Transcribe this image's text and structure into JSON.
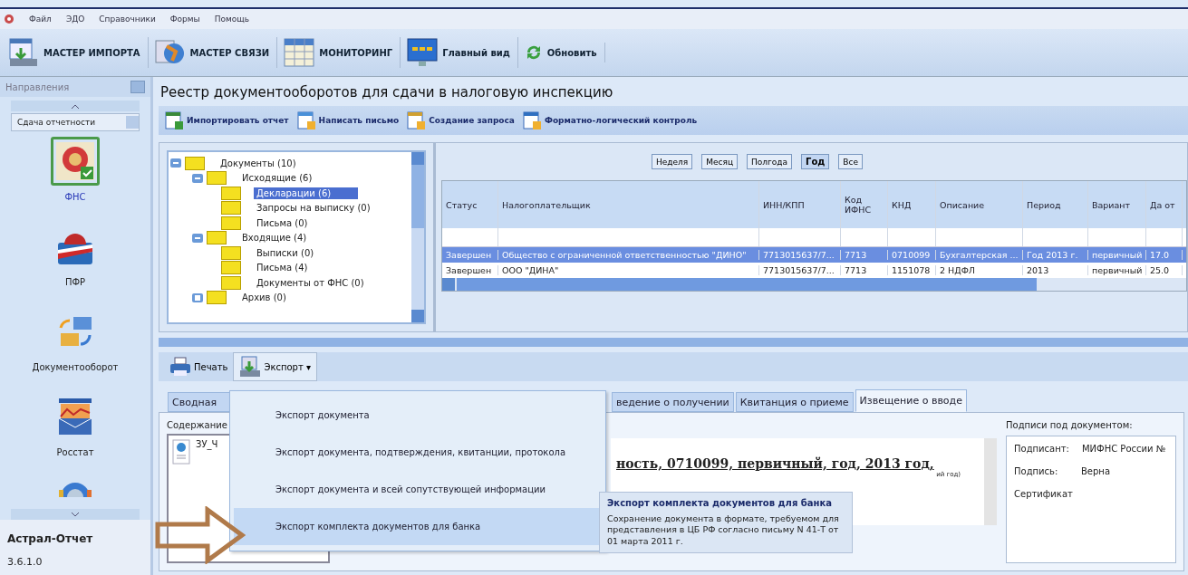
{
  "menu_bar": [
    "Файл",
    "ЭДО",
    "Справочники",
    "Формы",
    "Помощь"
  ],
  "toolbar": [
    {
      "label": "МАСТЕР ИМПОРТА",
      "kind": "import"
    },
    {
      "label": "МАСТЕР СВЯЗИ",
      "kind": "link"
    },
    {
      "label": "МОНИТОРИНГ",
      "kind": "grid"
    },
    {
      "label": "Главный вид",
      "kind": "monitor"
    },
    {
      "label": "Обновить",
      "kind": "refresh"
    }
  ],
  "sidebar": {
    "header": "Направления",
    "dropdown": "Сдача отчетности",
    "items": [
      {
        "label": "ФНС",
        "kind": "fns",
        "selected": true
      },
      {
        "label": "ПФР",
        "kind": "pfr",
        "selected": false
      },
      {
        "label": "Документооборот",
        "kind": "docs",
        "selected": false
      },
      {
        "label": "Росстат",
        "kind": "stat",
        "selected": false
      }
    ],
    "app_name": "Астрал-Отчет",
    "version": "3.6.1.0"
  },
  "title": "Реестр документооборотов для сдачи в налоговую инспекцию",
  "actions": [
    {
      "label": "Импортировать отчет",
      "kind": "import"
    },
    {
      "label": "Написать письмо",
      "kind": "mail"
    },
    {
      "label": "Создание запроса",
      "kind": "request"
    },
    {
      "label": "Форматно-логический контроль",
      "kind": "check"
    }
  ],
  "tree": [
    {
      "label": "Документы (10)",
      "expanded": true,
      "selected": false,
      "children": [
        {
          "label": "Исходящие (6)",
          "expanded": true,
          "selected": false,
          "children": [
            {
              "label": "Декларации (6)",
              "selected": true
            },
            {
              "label": "Запросы на выписку (0)",
              "selected": false
            },
            {
              "label": "Письма (0)",
              "selected": false
            }
          ]
        },
        {
          "label": "Входящие (4)",
          "expanded": true,
          "selected": false,
          "children": [
            {
              "label": "Выписки (0)",
              "selected": false
            },
            {
              "label": "Письма (4)",
              "selected": false
            },
            {
              "label": "Документы от ФНС (0)",
              "selected": false
            }
          ]
        },
        {
          "label": "Архив (0)",
          "expanded": false,
          "selected": false
        }
      ]
    }
  ],
  "periods": [
    {
      "label": "Неделя",
      "selected": false
    },
    {
      "label": "Месяц",
      "selected": false
    },
    {
      "label": "Полгода",
      "selected": false
    },
    {
      "label": "Год",
      "selected": true
    },
    {
      "label": "Все",
      "selected": false
    }
  ],
  "table": {
    "columns": [
      "Статус",
      "Налогоплательщик",
      "ИНН/КПП",
      "Код ИФНС",
      "КНД",
      "Описание",
      "Период",
      "Вариант",
      "Да от"
    ],
    "rows": [
      {
        "selected": true,
        "cells": [
          "Завершен",
          "Общество с ограниченной ответственностью \"ДИНО\"",
          "7713015637/7...",
          "7713",
          "0710099",
          "Бухгалтерская ...",
          "Год 2013 г.",
          "первичный",
          "17.0"
        ]
      },
      {
        "selected": false,
        "cells": [
          "Завершен",
          "ООО \"ДИНА\"",
          "7713015637/7...",
          "7713",
          "1151078",
          "2 НДФЛ",
          "2013",
          "первичный",
          "25.0"
        ]
      }
    ]
  },
  "bottom_toolbar": [
    {
      "label": "Печать",
      "kind": "print"
    },
    {
      "label": "Экспорт ▾",
      "kind": "export"
    }
  ],
  "tabs": [
    {
      "label": "Сводная",
      "selected": false
    },
    {
      "label": "ведение о получении",
      "selected": false
    },
    {
      "label": "Квитанция о приеме",
      "selected": false
    },
    {
      "label": "Извещение о вводе",
      "selected": true
    }
  ],
  "content_label": "Содержание",
  "file_name": "ЗУ_Ч",
  "document_heading": "ность, 0710099, первичный, год, 2013 год,",
  "document_note": "ий год)",
  "signatures": {
    "title": "Подписи под документом:",
    "rows": [
      {
        "label": "Подписант:",
        "value": "МИФНС России №"
      },
      {
        "label": "Подпись:",
        "value": "Верна"
      },
      {
        "label": "Сертификат"
      }
    ]
  },
  "export_menu": [
    {
      "label": "Экспорт документа",
      "selected": false
    },
    {
      "label": "Экспорт документа, подтверждения, квитанции, протокола",
      "selected": false
    },
    {
      "label": "Экспорт документа и всей сопутствующей информации",
      "selected": false
    },
    {
      "label": "Экспорт комплекта документов для банка",
      "selected": true
    }
  ],
  "tooltip": {
    "title": "Экспорт комплекта документов для банка",
    "text": "Сохранение документа в формате, требуемом для представления в ЦБ РФ согласно письму N 41-Т от 01 марта 2011 г."
  }
}
